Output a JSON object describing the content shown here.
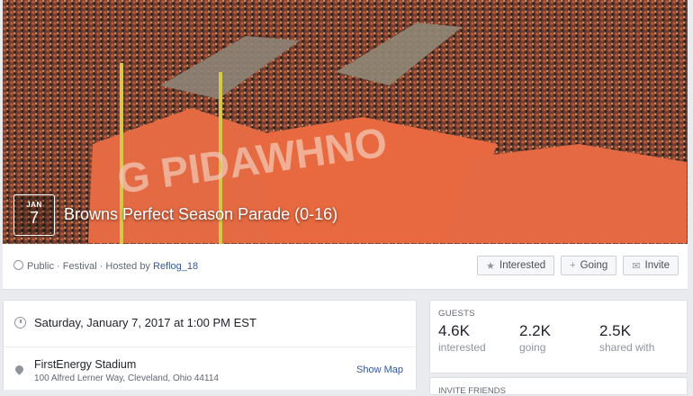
{
  "cover": {
    "date_month": "JAN",
    "date_day": "7",
    "title": "Browns Perfect Season Parade (0-16)"
  },
  "meta": {
    "privacy": "Public · Festival · Hosted by ",
    "host": "Reflog_18"
  },
  "actions": {
    "interested": "Interested",
    "going": "Going",
    "invite": "Invite"
  },
  "details": {
    "datetime": "Saturday, January 7, 2017 at 1:00 PM EST",
    "venue": "FirstEnergy Stadium",
    "address": "100 Alfred Lerner Way, Cleveland, Ohio 44114",
    "show_map": "Show Map"
  },
  "guests": {
    "header": "GUESTS",
    "stats": [
      {
        "value": "4.6K",
        "label": "interested"
      },
      {
        "value": "2.2K",
        "label": "going"
      },
      {
        "value": "2.5K",
        "label": "shared with"
      }
    ]
  },
  "invite_friends": {
    "header": "INVITE FRIENDS"
  },
  "icons": {
    "star": "star-icon",
    "plus": "plus-icon",
    "mail": "mail-icon"
  },
  "colors": {
    "link": "#365899",
    "page_bg": "#e9ebee"
  }
}
